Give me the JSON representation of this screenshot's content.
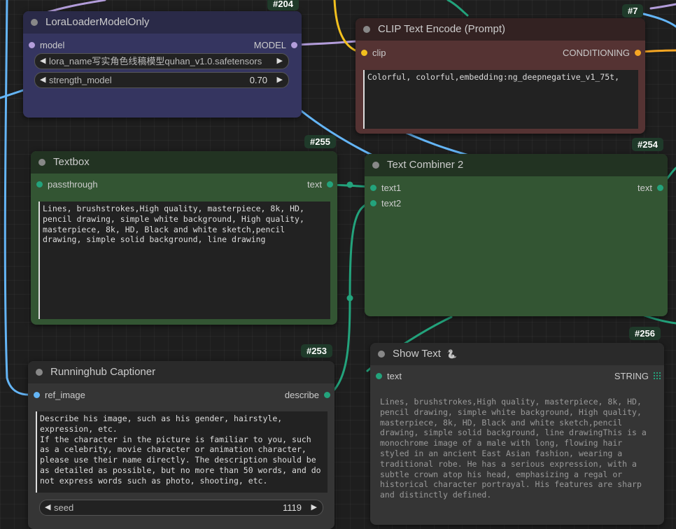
{
  "colors": {
    "canvas": "#1e1e1e",
    "wire_blue": "#64b5f6",
    "wire_teal": "#23a37c",
    "wire_yellow": "#f2c01e",
    "wire_purple": "#b39ddb"
  },
  "nodes": {
    "lora": {
      "badge": "#204",
      "title": "LoraLoaderModelOnly",
      "input": "model",
      "output": "MODEL",
      "lora_name": "lora_name写实角色线稿模型quhan_v1.0.safetensors",
      "strength_label": "strength_model",
      "strength_value": "0.70"
    },
    "clip": {
      "badge": "#7",
      "title": "CLIP Text Encode (Prompt)",
      "input": "clip",
      "output": "CONDITIONING",
      "text": "Colorful, colorful,embedding:ng_deepnegative_v1_75t,"
    },
    "textbox": {
      "badge": "#255",
      "title": "Textbox",
      "input": "passthrough",
      "output": "text",
      "text": "Lines, brushstrokes,High quality, masterpiece, 8k, HD, pencil drawing, simple white background, High quality, masterpiece, 8k, HD, Black and white sketch,pencil drawing, simple solid background, line drawing"
    },
    "combiner": {
      "badge": "#254",
      "title": "Text Combiner 2",
      "input1": "text1",
      "input2": "text2",
      "output": "text"
    },
    "captioner": {
      "badge": "#253",
      "title": "Runninghub Captioner",
      "input": "ref_image",
      "output": "describe",
      "text": "Describe his image, such as his gender, hairstyle, expression, etc.\nIf the character in the picture is familiar to you, such as a celebrity, movie character or animation character, please use their name directly. The description should be as detailed as possible, but no more than 50 words, and do not express words such as photo, shooting, etc.",
      "seed_label": "seed",
      "seed_value": "1119"
    },
    "showtext": {
      "badge": "#256",
      "title": "Show Text",
      "title_icon": "🐍",
      "input": "text",
      "output": "STRING",
      "text": "Lines, brushstrokes,High quality, masterpiece, 8k, HD, pencil drawing, simple white background, High quality, masterpiece, 8k, HD, Black and white sketch,pencil drawing, simple solid background, line drawingThis is a monochrome image of a male with long, flowing hair styled in an ancient East Asian fashion, wearing a traditional robe. He has a serious expression, with a subtle crown atop his head, emphasizing a regal or historical character portrayal. His features are sharp and distinctly defined."
    }
  }
}
